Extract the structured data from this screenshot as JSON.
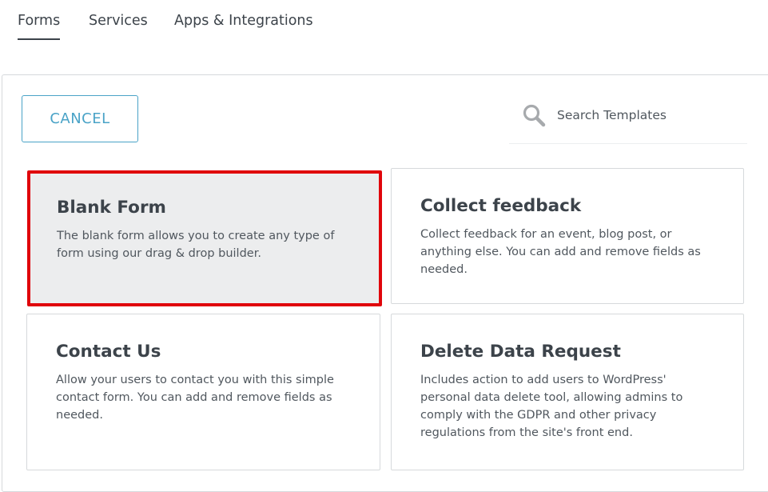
{
  "tabs": [
    {
      "label": "Forms",
      "active": true
    },
    {
      "label": "Services",
      "active": false
    },
    {
      "label": "Apps & Integrations",
      "active": false
    }
  ],
  "toolbar": {
    "cancel_label": "CANCEL"
  },
  "search": {
    "placeholder": "Search Templates",
    "value": "",
    "icon": "search-icon"
  },
  "templates": [
    {
      "title": "Blank Form",
      "description": "The blank form allows you to create any type of form using our drag & drop builder.",
      "selected": true
    },
    {
      "title": "Collect feedback",
      "description": "Collect feedback for an event, blog post, or anything else. You can add and remove fields as needed.",
      "selected": false
    },
    {
      "title": "Contact Us",
      "description": "Allow your users to contact you with this simple contact form. You can add and remove fields as needed.",
      "selected": false
    },
    {
      "title": "Delete Data Request",
      "description": "Includes action to add users to WordPress' personal data delete tool, allowing admins to comply with the GDPR and other privacy regulations from the site's front end.",
      "selected": false
    }
  ],
  "colors": {
    "accent": "#4aa3c7",
    "selection_outline": "#e0050b",
    "selected_card_bg": "#ecedee",
    "text": "#3c434a"
  }
}
